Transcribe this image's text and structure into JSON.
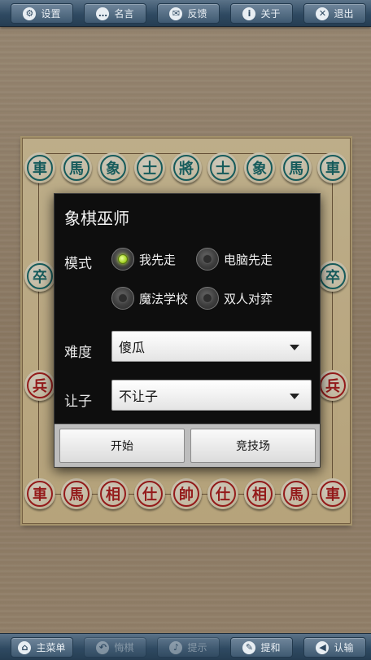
{
  "toolbar_top": {
    "settings": "设置",
    "quotes": "名言",
    "feedback": "反馈",
    "about": "关于",
    "exit": "退出"
  },
  "toolbar_bottom": {
    "main_menu": "主菜单",
    "undo": "悔棋",
    "hint": "提示",
    "draw": "提和",
    "resign": "认输"
  },
  "board": {
    "black_back_row": [
      "車",
      "馬",
      "象",
      "士",
      "將",
      "士",
      "象",
      "馬",
      "車"
    ],
    "red_back_row": [
      "車",
      "馬",
      "相",
      "仕",
      "帥",
      "仕",
      "相",
      "馬",
      "車"
    ],
    "black_pawn": "卒",
    "red_pawn": "兵"
  },
  "dialog": {
    "title": "象棋巫师",
    "mode_label": "模式",
    "mode_options": [
      "我先走",
      "电脑先走",
      "魔法学校",
      "双人对弈"
    ],
    "mode_selected": "我先走",
    "difficulty_label": "难度",
    "difficulty_value": "傻瓜",
    "handicap_label": "让子",
    "handicap_value": "不让子",
    "start_button": "开始",
    "arena_button": "竞技场"
  }
}
